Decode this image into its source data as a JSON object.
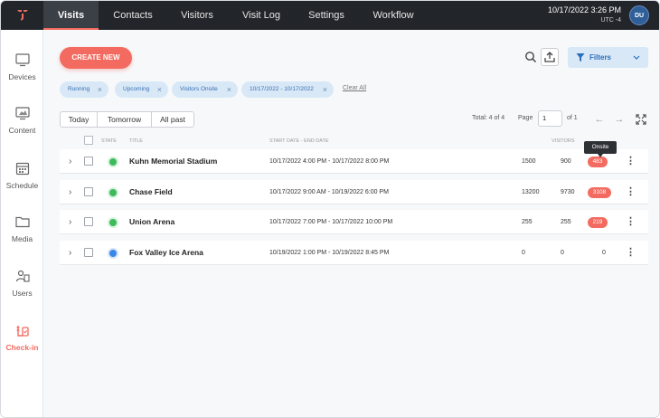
{
  "topnav": {
    "tabs": [
      {
        "label": "Visits"
      },
      {
        "label": "Contacts"
      },
      {
        "label": "Visitors"
      },
      {
        "label": "Visit Log"
      },
      {
        "label": "Settings"
      },
      {
        "label": "Workflow"
      }
    ],
    "datetime": "10/17/2022 3:26 PM",
    "timezone": "UTC -4",
    "avatar_initials": "DU"
  },
  "sidebar": {
    "items": [
      {
        "label": "Devices",
        "icon": "monitor-icon"
      },
      {
        "label": "Content",
        "icon": "content-icon"
      },
      {
        "label": "Schedule",
        "icon": "calendar-icon"
      },
      {
        "label": "Media",
        "icon": "folder-icon"
      },
      {
        "label": "Users",
        "icon": "users-icon"
      },
      {
        "label": "Check-in",
        "icon": "check-in-icon"
      }
    ]
  },
  "toolbar": {
    "create_label": "CREATE NEW",
    "filters_label": "Filters"
  },
  "chips": [
    {
      "label": "Running"
    },
    {
      "label": "Upcoming"
    },
    {
      "label": "Visitors Onsite"
    },
    {
      "label": "10/17/2022 - 10/17/2022"
    }
  ],
  "clear_all": "Clear All",
  "range_tabs": [
    "Today",
    "Tomorrow",
    "All past"
  ],
  "pagination": {
    "total": "Total: 4 of 4",
    "page_label": "Page",
    "page_value": "1",
    "of_label": "of 1"
  },
  "table": {
    "headers": {
      "state": "STATE",
      "title": "TITLE",
      "dates": "START DATE - END DATE",
      "visitors": "VISITORS"
    },
    "rows": [
      {
        "title": "Kuhn Memorial Stadium",
        "dates": "10/17/2022 4:00 PM - 10/17/2022 8:00 PM",
        "col1": "1500",
        "col2": "900",
        "onsite": "483",
        "state_color": "#3dbb5b"
      },
      {
        "title": "Chase Field",
        "dates": "10/17/2022 9:00 AM - 10/19/2022 6:00 PM",
        "col1": "13200",
        "col2": "9730",
        "onsite": "3108",
        "state_color": "#3dbb5b"
      },
      {
        "title": "Union Arena",
        "dates": "10/17/2022 7:00 PM - 10/17/2022 10:00 PM",
        "col1": "255",
        "col2": "255",
        "onsite": "219",
        "state_color": "#3dbb5b"
      },
      {
        "title": "Fox Valley Ice Arena",
        "dates": "10/19/2022 1:00 PM - 10/19/2022 8:45 PM",
        "col1": "0",
        "col2": "0",
        "onsite": "0",
        "state_color": "#3b87e6"
      }
    ]
  },
  "tooltip": "Onsite",
  "colors": {
    "accent": "#f36b60",
    "topbar": "#22252a",
    "filter_blue": "#2a6ebb"
  }
}
